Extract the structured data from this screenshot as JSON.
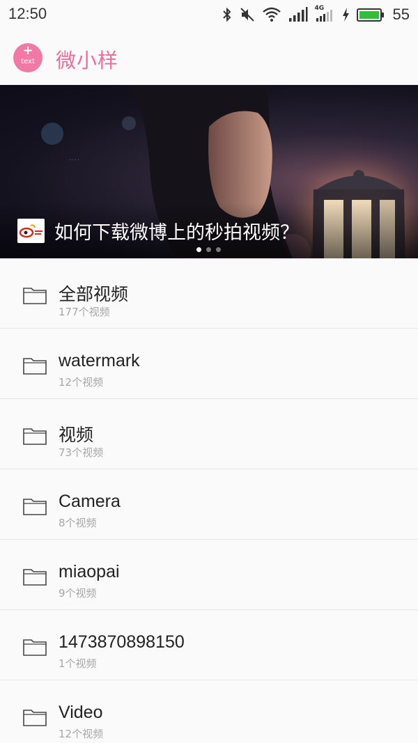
{
  "status_bar": {
    "time": "12:50",
    "network_label": "4G",
    "battery_level": "55",
    "battery_color": "#2fbf3a"
  },
  "header": {
    "add_button": {
      "plus": "+",
      "label": "text"
    },
    "title": "微小样",
    "accent_color": "#ee6c99"
  },
  "banner": {
    "title": "如何下载微博上的秒拍视频？",
    "logo_icon": "weibo-logo",
    "slides": 3,
    "active_slide": 1
  },
  "folders": [
    {
      "name": "全部视频",
      "count": "177个视频"
    },
    {
      "name": "watermark",
      "count": "12个视频"
    },
    {
      "name": "视频",
      "count": "73个视频"
    },
    {
      "name": "Camera",
      "count": "8个视频"
    },
    {
      "name": "miaopai",
      "count": "9个视频"
    },
    {
      "name": "1473870898150",
      "count": "1个视频"
    },
    {
      "name": "Video",
      "count": "12个视频"
    }
  ]
}
